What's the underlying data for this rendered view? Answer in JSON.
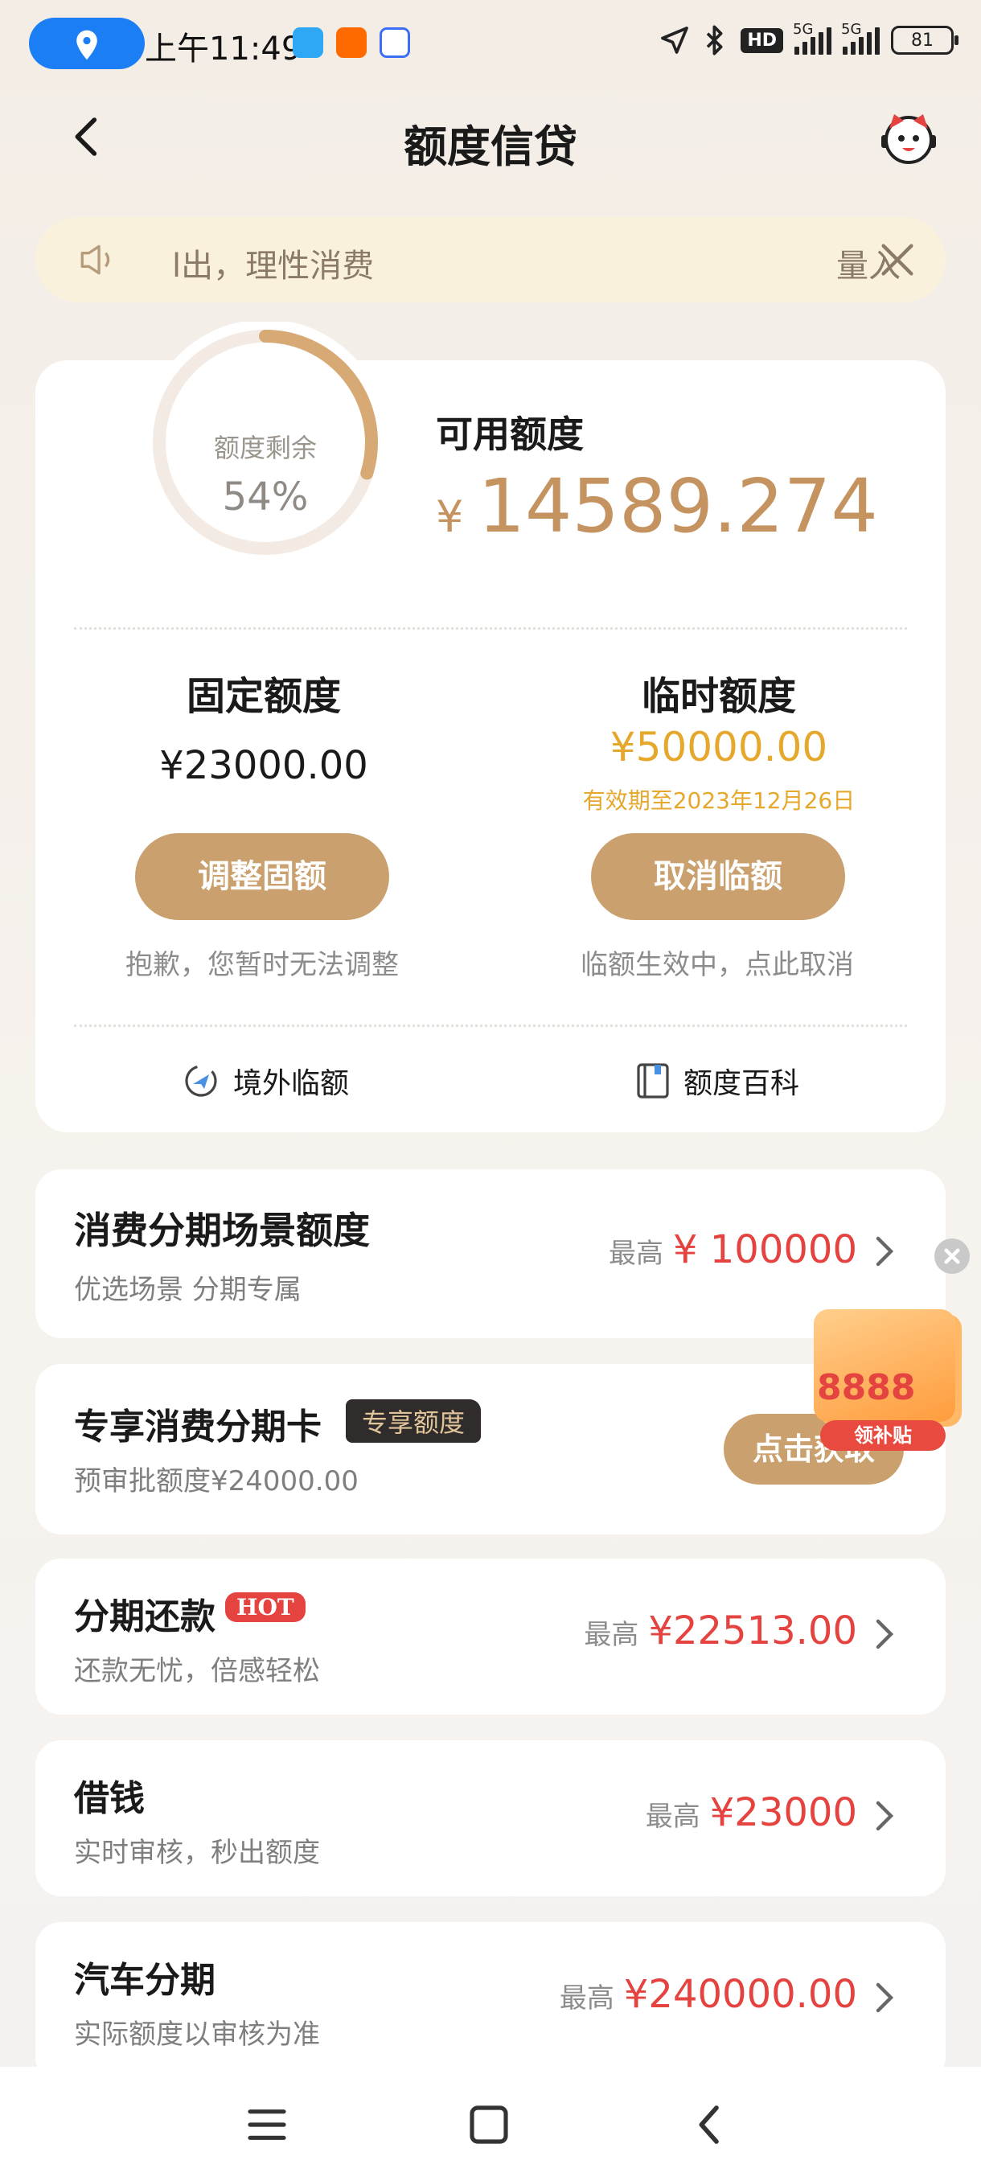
{
  "status_bar": {
    "time": "上午11:49",
    "network_1": "5G",
    "network_2": "5G",
    "hd": "HD",
    "battery": "81"
  },
  "header": {
    "title": "额度信贷"
  },
  "notice": {
    "text": "l出，理性消费",
    "text_tail": "量入"
  },
  "credit": {
    "ring_label": "额度剩余",
    "ring_percent": "54%",
    "ring_fraction": 0.54,
    "available_label": "可用额度",
    "currency": "¥",
    "available_amount": "14589.274",
    "fixed": {
      "title": "固定额度",
      "amount": "¥23000.00",
      "button": "调整固额",
      "note": "抱歉，您暂时无法调整"
    },
    "temporary": {
      "title": "临时额度",
      "amount": "¥50000.00",
      "validity": "有效期至2023年12月26日",
      "button": "取消临额",
      "note": "临额生效中，点此取消"
    },
    "links": {
      "overseas": "境外临额",
      "encyclopedia": "额度百科"
    }
  },
  "items": {
    "installment_scene": {
      "title": "消费分期场景额度",
      "subtitle": "优选场景 分期专属",
      "prefix": "最高",
      "amount": "¥ 100000"
    },
    "exclusive_card": {
      "title": "专享消费分期卡",
      "tag": "专享额度",
      "subtitle": "预审批额度¥24000.00",
      "button": "点击获取"
    },
    "installment_repay": {
      "title": "分期还款",
      "tag": "HOT",
      "subtitle": "还款无忧，倍感轻松",
      "prefix": "最高",
      "amount": "¥22513.00"
    },
    "borrow": {
      "title": "借钱",
      "subtitle": "实时审核，秒出额度",
      "prefix": "最高",
      "amount": "¥23000"
    },
    "car_loan": {
      "title": "汽车分期",
      "subtitle": "实际额度以审核为准",
      "prefix": "最高",
      "amount": "¥240000.00"
    }
  },
  "promo": {
    "number": "8888",
    "ribbon": "领补贴"
  },
  "colors": {
    "gold": "#c9a06e",
    "amount_red": "#e4433f",
    "temp_gold": "#e6a82c",
    "ring_track": "#f3ebe3",
    "ring_fill": "#d7a974"
  }
}
